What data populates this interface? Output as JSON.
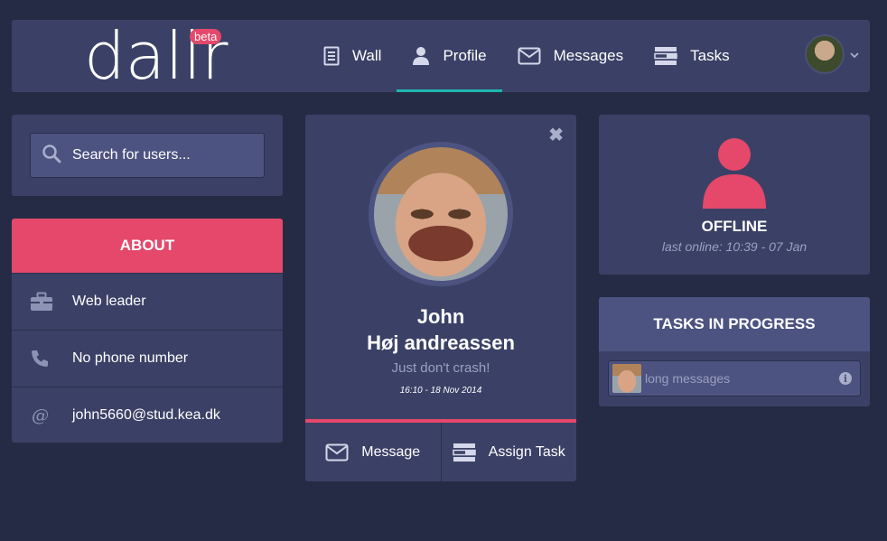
{
  "app": {
    "logo": "dallr",
    "badge": "beta"
  },
  "nav": {
    "items": [
      {
        "label": "Wall",
        "icon": "document-icon"
      },
      {
        "label": "Profile",
        "icon": "user-icon",
        "active": true
      },
      {
        "label": "Messages",
        "icon": "envelope-icon"
      },
      {
        "label": "Tasks",
        "icon": "tasks-icon"
      }
    ]
  },
  "search": {
    "placeholder": "Search for users..."
  },
  "about": {
    "title": "ABOUT",
    "rows": [
      {
        "icon": "briefcase-icon",
        "text": "Web leader"
      },
      {
        "icon": "phone-icon",
        "text": "No phone number"
      },
      {
        "icon": "at-icon",
        "text": "john5660@stud.kea.dk"
      }
    ]
  },
  "profile": {
    "first_name": "John",
    "last_name": "Høj andreassen",
    "status": "Just don't crash!",
    "timestamp": "16:10 - 18 Nov 2014",
    "message_button": "Message",
    "assign_button": "Assign Task"
  },
  "presence": {
    "state": "OFFLINE",
    "last_online": "last online: 10:39 - 07 Jan"
  },
  "tasks": {
    "title": "TASKS IN PROGRESS",
    "items": [
      {
        "text": "long messages"
      }
    ]
  },
  "colors": {
    "background": "#262b45",
    "panel": "#3b4166",
    "accent": "#e5486a",
    "active_tab": "#1fb5ac"
  }
}
